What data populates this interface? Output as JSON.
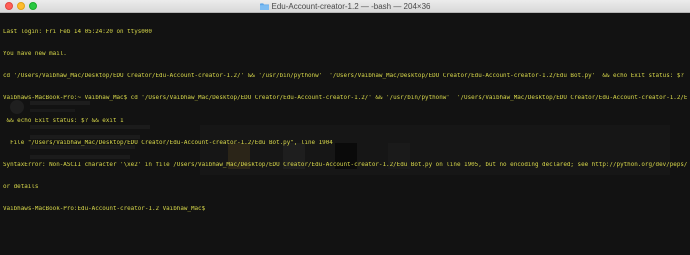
{
  "window": {
    "title": "Edu-Account-creator-1.2 — -bash — 204×36",
    "folder_icon": "folder-icon",
    "buttons": [
      "close",
      "minimize",
      "zoom"
    ]
  },
  "colors": {
    "terminal_bg": "#121212",
    "terminal_text": "#d8d84a",
    "titlebar": "#e2e2e2"
  },
  "terminal": {
    "lines": [
      "Last login: Fri Feb 14 05:24:20 on ttys000",
      "You have new mail.",
      "cd '/Users/Vaibhaw_Mac/Desktop/EDU Creator/Edu-Account-creator-1.2/' && '/usr/bin/pythonw'  '/Users/Vaibhaw_Mac/Desktop/EDU Creator/Edu-Account-creator-1.2/Edu Bot.py'  && echo Exit status: $? && exit 1",
      "Vaibhaws-MacBook-Pro:~ Vaibhaw_Mac$ cd '/Users/Vaibhaw_Mac/Desktop/EDU Creator/Edu-Account-creator-1.2/' && '/usr/bin/pythonw'  '/Users/Vaibhaw_Mac/Desktop/EDU Creator/Edu-Account-creator-1.2/Edu Bot.py'",
      " && echo Exit status: $? && exit 1",
      "  File \"/Users/Vaibhaw_Mac/Desktop/EDU Creator/Edu-Account-creator-1.2/Edu Bot.py\", line 1904",
      "SyntaxError: Non-ASCII character '\\xe2' in file /Users/Vaibhaw_Mac/Desktop/EDU Creator/Edu-Account-creator-1.2/Edu Bot.py on line 1905, but no encoding declared; see http://python.org/dev/peps/pep-0263/ f",
      "or details",
      "Vaibhaws-MacBook-Pro:Edu-Account-creator-1.2 Vaibhaw_Mac$"
    ]
  }
}
